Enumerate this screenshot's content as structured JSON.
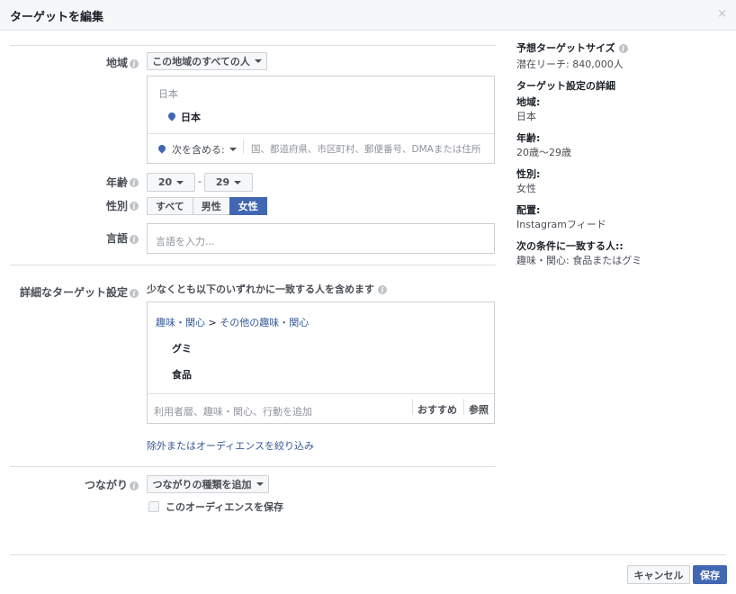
{
  "header": {
    "title": "ターゲットを編集",
    "close": "×"
  },
  "location": {
    "label": "地域",
    "scope_select": "この地域のすべての人",
    "country_header": "日本",
    "selected_country": "日本",
    "include_select": "次を含める:",
    "search_placeholder": "国、都道府県、市区町村、郵便番号、DMAまたは住所"
  },
  "age": {
    "label": "年齢",
    "min": "20",
    "max": "29",
    "separator": "-"
  },
  "gender": {
    "label": "性別",
    "options": [
      "すべて",
      "男性",
      "女性"
    ],
    "selected": "女性"
  },
  "language": {
    "label": "言語",
    "placeholder": "言語を入力..."
  },
  "detailed": {
    "label": "詳細なターゲット設定",
    "description": "少なくとも以下のいずれかに一致する人を含めます",
    "category_path": "趣味・関心",
    "category_sep": ">",
    "category_sub": "その他の趣味・関心",
    "items": [
      "グミ",
      "食品"
    ],
    "search_placeholder": "利用者層、趣味・関心、行動を追加",
    "suggest": "おすすめ",
    "browse": "参照",
    "exclude_prefix": "除外または",
    "exclude_link": "オーディエンスを絞り込み"
  },
  "connections": {
    "label": "つながり",
    "select": "つながりの種類を追加",
    "save_audience": "このオーディエンスを保存"
  },
  "sidebar": {
    "size_title": "予想ターゲットサイズ",
    "reach": "潜在リーチ: 840,000人",
    "details_title": "ターゲット設定の詳細",
    "sections": [
      {
        "h": "地域:",
        "t": "日本"
      },
      {
        "h": "年齢:",
        "t": "20歳〜29歳"
      },
      {
        "h": "性別:",
        "t": "女性"
      },
      {
        "h": "配置:",
        "t": "Instagramフィード"
      },
      {
        "h": "次の条件に一致する人::",
        "t": "趣味・関心: 食品またはグミ"
      }
    ]
  },
  "footer": {
    "cancel": "キャンセル",
    "save": "保存"
  }
}
